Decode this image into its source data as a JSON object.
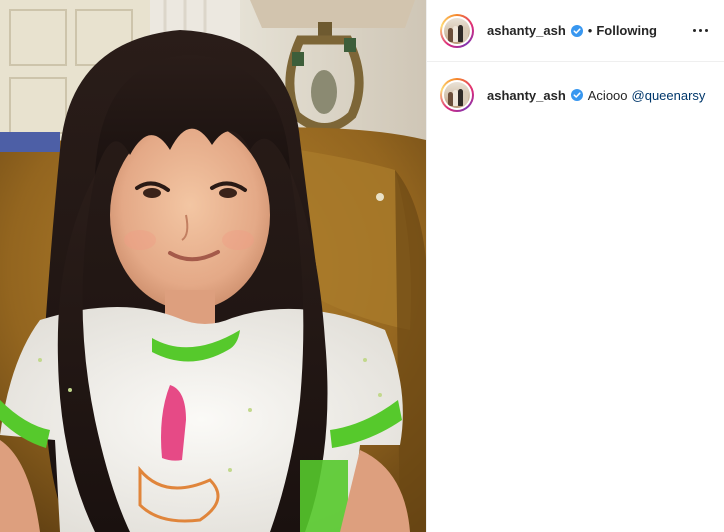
{
  "post": {
    "image": {
      "alt": "Young girl with long dark hair and bangs sitting on a gold velvet sofa"
    },
    "header": {
      "username": "ashanty_ash",
      "verified": true,
      "separator": "•",
      "follow_status": "Following",
      "more_icon": "more-horizontal-icon"
    },
    "caption": {
      "username": "ashanty_ash",
      "verified": true,
      "text": "Aciooo",
      "mention": "@queenarsy"
    }
  },
  "colors": {
    "verified_badge": "#3897f0",
    "mention": "#00376b",
    "divider": "#efefef"
  }
}
